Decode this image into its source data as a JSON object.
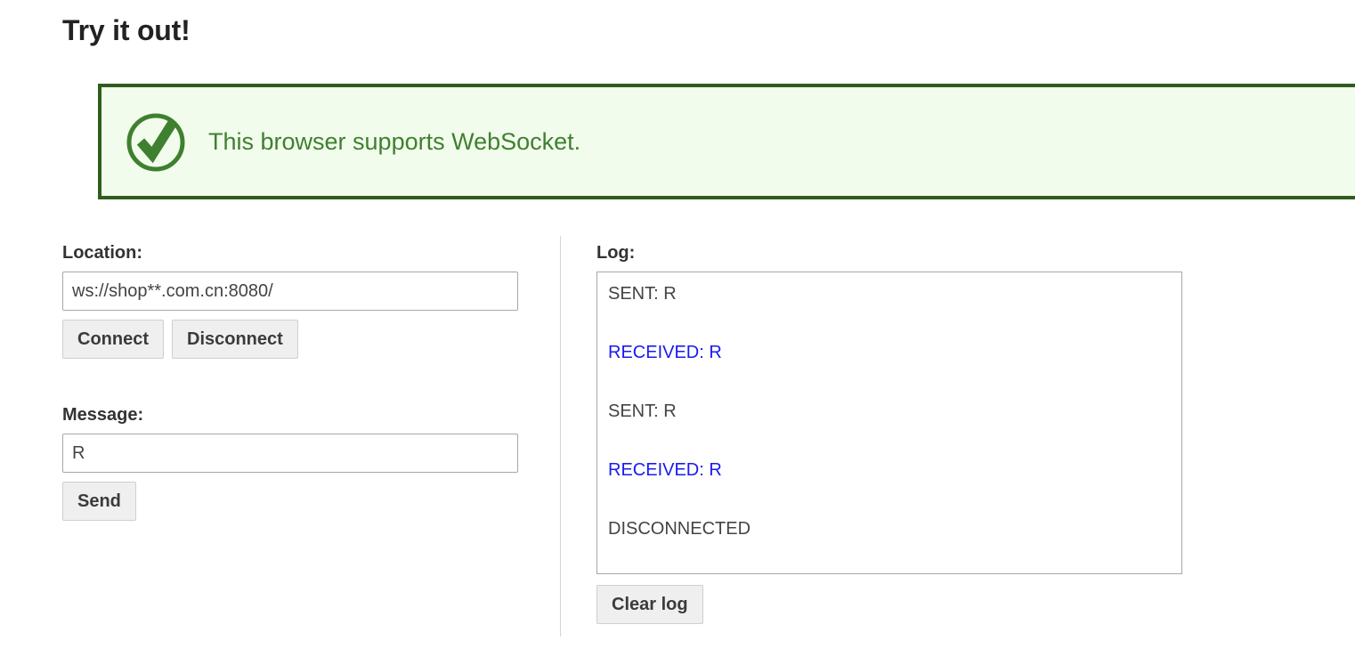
{
  "page": {
    "title": "Try it out!"
  },
  "banner": {
    "icon": "check-circle-icon",
    "message": "This browser supports WebSocket.",
    "border_color": "#2f5d1c",
    "background_color": "#f2fcec",
    "text_color": "#3f8030"
  },
  "location": {
    "label": "Location:",
    "value": "ws://shop**.com.cn:8080/",
    "placeholder": "ws://",
    "connect_label": "Connect",
    "disconnect_label": "Disconnect"
  },
  "message": {
    "label": "Message:",
    "value": "R",
    "placeholder": "",
    "send_label": "Send"
  },
  "log": {
    "label": "Log:",
    "clear_label": "Clear log",
    "sent_color": "#444444",
    "received_color": "#1a1af0",
    "entries": [
      {
        "text": "SENT: R",
        "kind": "sent"
      },
      {
        "text": "RECEIVED: R",
        "kind": "received"
      },
      {
        "text": "SENT: R",
        "kind": "sent"
      },
      {
        "text": "RECEIVED: R",
        "kind": "received"
      },
      {
        "text": "DISCONNECTED",
        "kind": "sent"
      }
    ]
  }
}
